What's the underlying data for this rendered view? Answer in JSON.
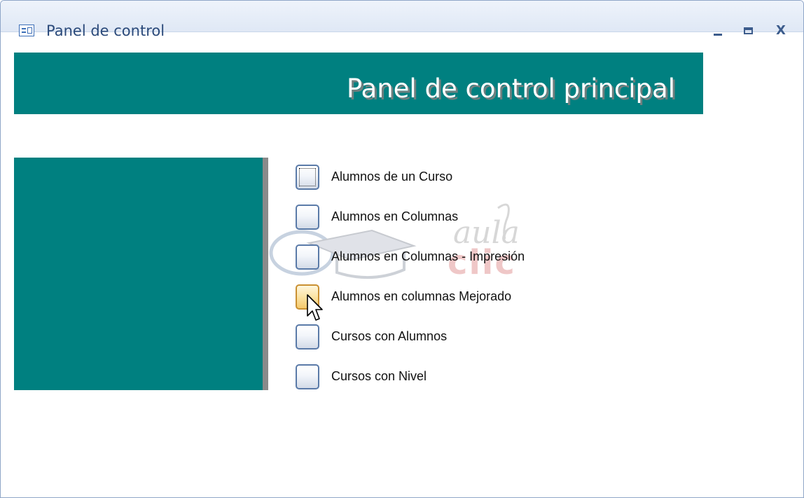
{
  "window": {
    "title": "Panel de control",
    "icon": "form-icon",
    "controls": {
      "minimize": "minimize-icon",
      "maximize": "maximize-icon",
      "close_label": "X"
    }
  },
  "header": {
    "title": "Panel de control principal"
  },
  "menu": {
    "items": [
      {
        "label": "Alumnos de un Curso",
        "state": "focused"
      },
      {
        "label": "Alumnos en Columnas",
        "state": "normal"
      },
      {
        "label": "Alumnos en Columnas - Impresión",
        "state": "normal"
      },
      {
        "label": "Alumnos en columnas Mejorado",
        "state": "hover"
      },
      {
        "label": "Cursos con Alumnos",
        "state": "normal"
      },
      {
        "label": "Cursos con Nivel",
        "state": "normal"
      }
    ]
  },
  "watermark": {
    "line1": "aula",
    "line2": "clic"
  },
  "colors": {
    "teal": "#008080",
    "divider": "#8a8a8a",
    "title_text": "#2b4a7a"
  }
}
